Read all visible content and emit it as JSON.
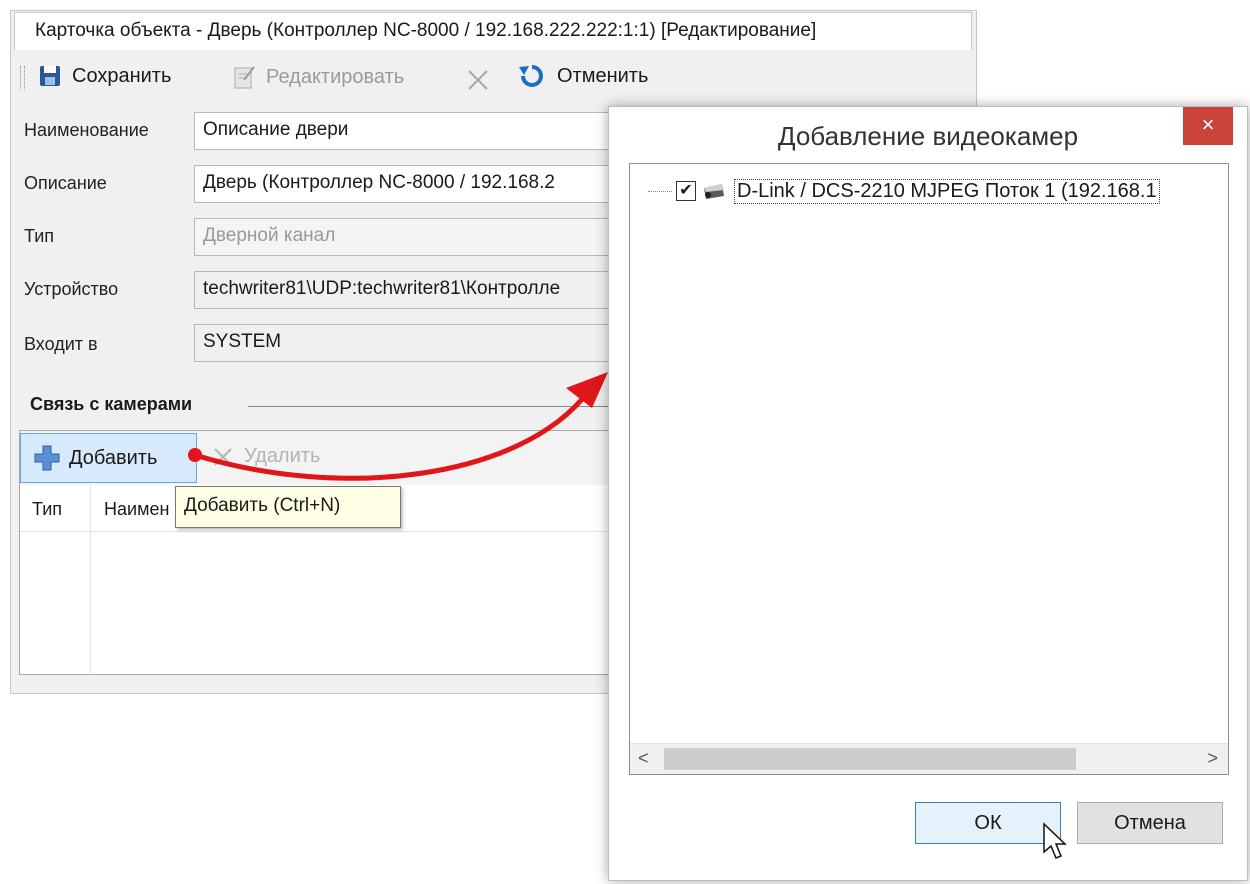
{
  "card": {
    "title": "Карточка объекта - Дверь (Контроллер NC-8000 / 192.168.222.222:1:1) [Редактирование]",
    "toolbar": {
      "save_label": "Сохранить",
      "edit_label": "Редактировать",
      "cancel_label": "Отменить"
    },
    "fields": {
      "name_label": "Наименование",
      "name_value": "Описание двери",
      "description_label": "Описание",
      "description_value": "Дверь (Контроллер NC-8000 / 192.168.2",
      "type_label": "Тип",
      "type_value": "Дверной канал",
      "device_label": "Устройство",
      "device_value": "techwriter81\\UDP:techwriter81\\Контролле",
      "member_label": "Входит в",
      "member_value": "SYSTEM"
    },
    "cameras_section": {
      "title": "Связь с камерами",
      "add_label": "Добавить",
      "delete_label": "Удалить",
      "columns": [
        "Тип",
        "Наимен"
      ],
      "tooltip": "Добавить (Ctrl+N)"
    }
  },
  "dialog": {
    "title": "Добавление видеокамер",
    "close_symbol": "×",
    "tree_items": [
      {
        "label": "D-Link / DCS-2210 MJPEG Поток 1 (192.168.1",
        "checked": true
      }
    ],
    "scroll_left": "<",
    "scroll_right": ">",
    "ok_label": "ОК",
    "cancel_label": "Отмена"
  },
  "colors": {
    "accent_blue": "#69a6e2",
    "close_red": "#c9433a",
    "arrow_red": "#e0161b",
    "tooltip_bg": "#ffffe6"
  },
  "icons": {
    "save": "floppy-disk-icon",
    "edit": "edit-note-icon",
    "delete": "x-icon",
    "undo": "undo-arrow-icon",
    "add": "plus-icon",
    "camera": "camera-icon",
    "cursor": "mouse-pointer-icon"
  }
}
